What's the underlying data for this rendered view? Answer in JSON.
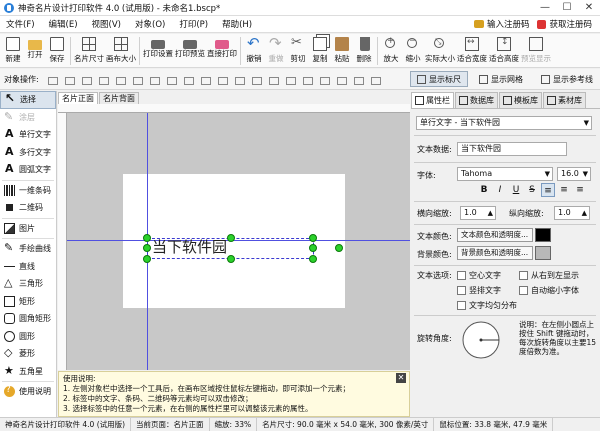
{
  "window": {
    "title": "神奇名片设计打印软件 4.0 (试用版) - 未命名1.bscp*",
    "controls": [
      "—",
      "☐",
      "✕"
    ]
  },
  "menu": {
    "items": [
      "文件(F)",
      "编辑(E)",
      "视图(V)",
      "对象(O)",
      "打印(P)",
      "帮助(H)"
    ],
    "register": "输入注册码",
    "buy": "获取注册码"
  },
  "toolbar": {
    "new": "新建",
    "open": "打开",
    "save": "保存",
    "card_size": "名片尺寸",
    "canvas_size": "画布大小",
    "print_settings": "打印设置",
    "print_preview": "打印预览",
    "direct_print": "直接打印",
    "undo": "撤销",
    "redo": "重做",
    "cut": "剪切",
    "copy": "复制",
    "paste": "粘贴",
    "delete": "删除",
    "zoom_in": "放大",
    "zoom_out": "缩小",
    "actual_size": "实际大小",
    "fit_width": "适合宽度",
    "fit_height": "适合高度",
    "preview": "预览显示"
  },
  "objbar": {
    "label": "对象操作:",
    "show_ruler": "显示标尺",
    "show_grid": "显示网格",
    "show_guides": "显示参考线"
  },
  "tools": {
    "select": "选择",
    "brush": "涂层",
    "single_text": "单行文字",
    "multi_text": "多行文字",
    "arc_text": "圆弧文字",
    "barcode": "一维条码",
    "qrcode": "二维码",
    "image": "图片",
    "freehand": "手绘曲线",
    "line": "直线",
    "triangle": "三角形",
    "rect": "矩形",
    "round_rect": "圆角矩形",
    "ellipse": "圆形",
    "diamond": "菱形",
    "star": "五角星",
    "help": "使用说明"
  },
  "canvas": {
    "tabs": [
      "名片正面",
      "名片背面"
    ],
    "element_text": "当下软件园"
  },
  "instructions": {
    "title": "使用说明:",
    "line1": "1. 左侧对象栏中选择一个工具后，在画布区域按住鼠标左键拖动，即可添加一个元素；",
    "line2": "2. 标签中的文字、条码、二维码等元素均可以双击修改；",
    "line3": "3. 选择标签中的任意一个元素，在右侧的属性栏里可以调整该元素的属性。",
    "close": "✕"
  },
  "right_panel": {
    "tabs": [
      "属性栏",
      "数据库",
      "模板库",
      "素材库"
    ],
    "object_type": "单行文字 - 当下软件园",
    "text_data_label": "文本数据:",
    "text_data_value": "当下软件园",
    "font_label": "字体:",
    "font_value": "Tahoma",
    "font_size": "16.0",
    "format_buttons": [
      "B",
      "I",
      "U",
      "S"
    ],
    "h_spacing_label": "横向缩放:",
    "h_spacing_value": "1.0",
    "v_spacing_label": "纵向缩放:",
    "v_spacing_value": "1.0",
    "text_color_label": "文本颜色:",
    "text_color_button": "文本颜色和透明度...",
    "text_color": "#000000",
    "bg_color_label": "背景颜色:",
    "bg_color_button": "背景颜色和透明度...",
    "bg_color": "#b8b8b8",
    "text_options_label": "文本选项:",
    "options": [
      "空心文字",
      "从右到左显示",
      "竖排文字",
      "自动缩小字体",
      "文字均匀分布"
    ],
    "rotation_label": "旋转角度:",
    "rotation_help": "说明：在左侧小圆点上按住 Shift 键拖动时，每次旋转角度以主要15度倍数为准。"
  },
  "status": {
    "app": "神奇名片设计打印软件 4.0 (试用版)",
    "page": "当前页面：名片正面",
    "zoom": "缩放: 33%",
    "size": "名片尺寸: 90.0 毫米 x 54.0 毫米, 300 像素/英寸",
    "mouse": "鼠标位置: 33.8 毫米, 47.9 毫米"
  }
}
